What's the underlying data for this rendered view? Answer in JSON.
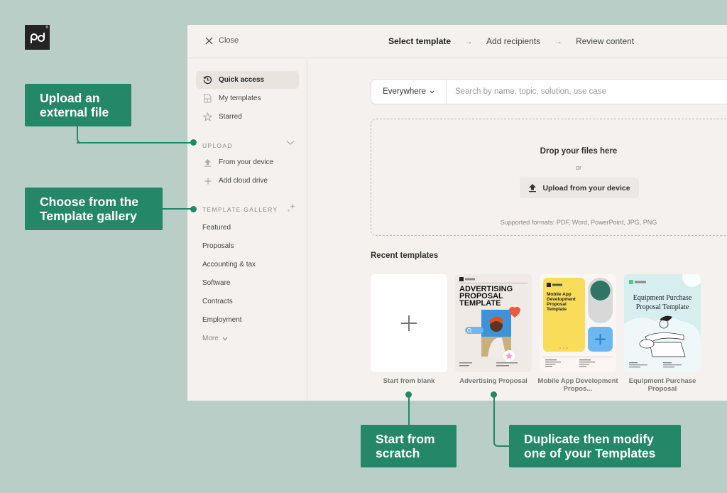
{
  "brand": {
    "logo_text": "pd",
    "registered_mark": "®"
  },
  "topbar": {
    "close_label": "Close",
    "steps": [
      {
        "label": "Select template",
        "active": true
      },
      {
        "label": "Add recipients",
        "active": false
      },
      {
        "label": "Review content",
        "active": false
      }
    ],
    "step_arrow": "→"
  },
  "sidebar": {
    "top_items": [
      {
        "label": "Quick access",
        "icon": "history-icon",
        "active": true
      },
      {
        "label": "My templates",
        "icon": "template-icon",
        "active": false
      },
      {
        "label": "Starred",
        "icon": "star-icon",
        "active": false
      }
    ],
    "upload_section": {
      "label": "UPLOAD",
      "items": [
        {
          "label": "From your device",
          "icon": "upload-icon"
        },
        {
          "label": "Add cloud drive",
          "icon": "plus-icon"
        }
      ]
    },
    "gallery_section": {
      "label": "TEMPLATE GALLERY",
      "items": [
        "Featured",
        "Proposals",
        "Accounting & tax",
        "Software",
        "Contracts",
        "Employment"
      ],
      "more_label": "More"
    }
  },
  "search": {
    "scope_value": "Everywhere",
    "placeholder": "Search by name, topic, solution, use case",
    "value": ""
  },
  "dropzone": {
    "title": "Drop your files here",
    "or_text": "or",
    "button_label": "Upload from your device",
    "formats_text": "Supported formats: PDF, Word, PowerPoint, JPG, PNG"
  },
  "recent": {
    "title": "Recent templates",
    "cards": [
      {
        "label": "Start from blank"
      },
      {
        "label": "Advertising Proposal",
        "thumb_title": "ADVERTISING PROPOSAL TEMPLATE",
        "thumb_brand": "PandaDoc"
      },
      {
        "label": "Mobile App Development Propos...",
        "thumb_title": "Mobile App Development Proposal Template",
        "thumb_brand": "PandaDoc"
      },
      {
        "label": "Equipment Purchase Proposal",
        "thumb_title": "Equipment Purchase Proposal Template",
        "thumb_brand": "PandaDoc"
      }
    ]
  },
  "callouts": {
    "upload": "Upload an external file",
    "gallery": "Choose from the Template gallery",
    "scratch": "Start from scratch",
    "duplicate": "Duplicate then modify one of your Templates"
  },
  "colors": {
    "callout_green": "#248767",
    "background": "#b8cec6",
    "panel": "#f4f1ee",
    "adv_heart": "#f05a3c",
    "mobile_yellow": "#f8dc5a",
    "mobile_teal": "#2f7565",
    "mobile_blue": "#6bb8f2",
    "equip_bg": "#d6eeee"
  }
}
